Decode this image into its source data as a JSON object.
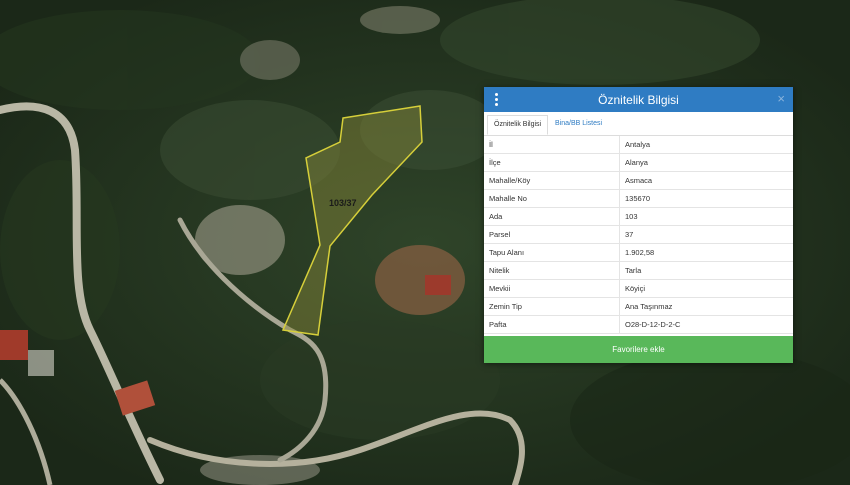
{
  "map": {
    "parcel_label": "103/37"
  },
  "popup": {
    "title": "Öznitelik Bilgisi",
    "close_glyph": "×",
    "tabs": [
      {
        "label": "Öznitelik Bilgisi",
        "active": true
      },
      {
        "label": "Bina/BB Listesi",
        "active": false
      }
    ],
    "rows": [
      {
        "key": "İl",
        "value": "Antalya"
      },
      {
        "key": "İlçe",
        "value": "Alanya"
      },
      {
        "key": "Mahalle/Köy",
        "value": "Asmaca"
      },
      {
        "key": "Mahalle No",
        "value": "135670"
      },
      {
        "key": "Ada",
        "value": "103"
      },
      {
        "key": "Parsel",
        "value": "37"
      },
      {
        "key": "Tapu Alanı",
        "value": "1.902,58"
      },
      {
        "key": "Nitelik",
        "value": "Tarla"
      },
      {
        "key": "Mevkii",
        "value": "Köyiçi"
      },
      {
        "key": "Zemin Tip",
        "value": "Ana Taşınmaz"
      },
      {
        "key": "Pafta",
        "value": "O28-D-12-D-2-C"
      }
    ],
    "favorite_button": "Favorilere ekle"
  },
  "colors": {
    "header": "#2f7cc3",
    "button": "#59b85a",
    "parcel_outline": "#d6cf3a"
  },
  "icons": [
    "menu-icon",
    "close-icon"
  ]
}
